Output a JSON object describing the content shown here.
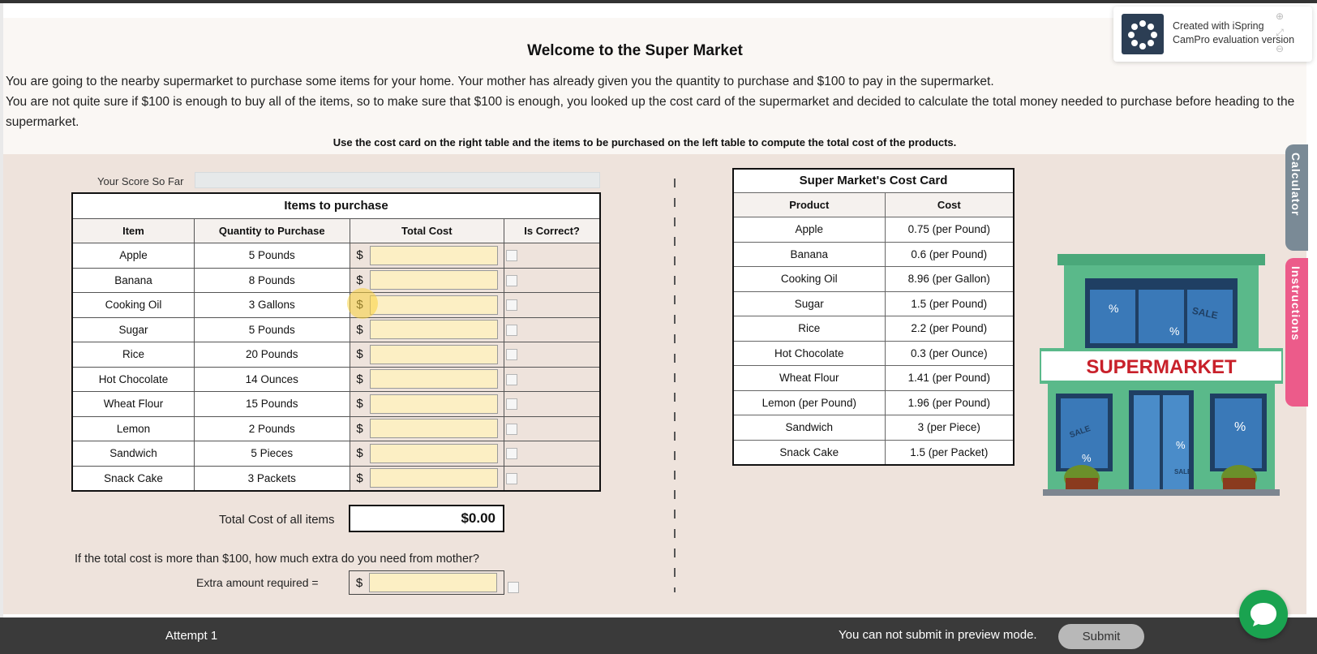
{
  "page": {
    "title": "Welcome to the Super Market",
    "intro_1": "You are going to the nearby supermarket to purchase some items for your home. Your mother has already given you the quantity to purchase and $100 to pay in the supermarket.",
    "intro_2": "You are not quite sure if $100 is enough to buy all of the items, so to make sure that $100 is enough, you looked up the cost card of the supermarket and decided to calculate the total money needed to purchase before heading to the supermarket.",
    "instruction": "Use the cost card on the right table and the items to be purchased on the left table to compute the total cost of the products."
  },
  "score": {
    "label": "Your Score So Far"
  },
  "items_table": {
    "caption": "Items to purchase",
    "headers": [
      "Item",
      "Quantity to Purchase",
      "Total Cost",
      "Is Correct?"
    ],
    "currency": "$",
    "rows": [
      {
        "item": "Apple",
        "quantity": "5 Pounds"
      },
      {
        "item": "Banana",
        "quantity": "8 Pounds"
      },
      {
        "item": "Cooking Oil",
        "quantity": "3 Gallons"
      },
      {
        "item": "Sugar",
        "quantity": "5 Pounds"
      },
      {
        "item": "Rice",
        "quantity": "20 Pounds"
      },
      {
        "item": "Hot Chocolate",
        "quantity": "14 Ounces"
      },
      {
        "item": "Wheat Flour",
        "quantity": "15 Pounds"
      },
      {
        "item": "Lemon",
        "quantity": "2 Pounds"
      },
      {
        "item": "Sandwich",
        "quantity": "5 Pieces"
      },
      {
        "item": "Snack Cake",
        "quantity": "3 Packets"
      }
    ]
  },
  "total": {
    "label": "Total Cost of all items",
    "value": "$0.00"
  },
  "extra": {
    "question": "If the total cost is more than $100, how much extra do you need from mother?",
    "label": "Extra amount required =",
    "currency": "$"
  },
  "cost_card": {
    "caption": "Super Market's Cost Card",
    "headers": [
      "Product",
      "Cost"
    ],
    "rows": [
      {
        "product": "Apple",
        "cost": "0.75 (per Pound)"
      },
      {
        "product": "Banana",
        "cost": "0.6 (per Pound)"
      },
      {
        "product": "Cooking Oil",
        "cost": "8.96 (per Gallon)"
      },
      {
        "product": "Sugar",
        "cost": "1.5 (per Pound)"
      },
      {
        "product": "Rice",
        "cost": "2.2 (per Pound)"
      },
      {
        "product": "Hot Chocolate",
        "cost": "0.3 (per Ounce)"
      },
      {
        "product": "Wheat Flour",
        "cost": "1.41 (per Pound)"
      },
      {
        "product": "Lemon (per Pound)",
        "cost": "1.96 (per Pound)"
      },
      {
        "product": "Sandwich",
        "cost": "3 (per Piece)"
      },
      {
        "product": "Snack Cake",
        "cost": "1.5 (per Packet)"
      }
    ]
  },
  "illustration": {
    "sign": "SUPERMARKET",
    "window_labels": [
      "%",
      "SALE",
      "%",
      "SALE",
      "%",
      "%",
      "%",
      "SALE"
    ]
  },
  "ispring": {
    "line_1": "Created with iSpring",
    "line_2": "CamPro evaluation version"
  },
  "side_tabs": {
    "calculator": "Calculator",
    "instructions": "Instructions"
  },
  "footer": {
    "attempt": "Attempt 1",
    "preview_message": "You can not submit in preview mode.",
    "submit": "Submit"
  },
  "colors": {
    "stage_bg": "#eee3dc",
    "input_bg": "#fcefc4",
    "calculator_tab": "#7a8a96",
    "instructions_tab": "#ec5b8a",
    "footer_bg": "#3a3a3a",
    "chat_button": "#1aa350",
    "sign_text": "#c8202a",
    "building_green": "#5ab98a"
  }
}
